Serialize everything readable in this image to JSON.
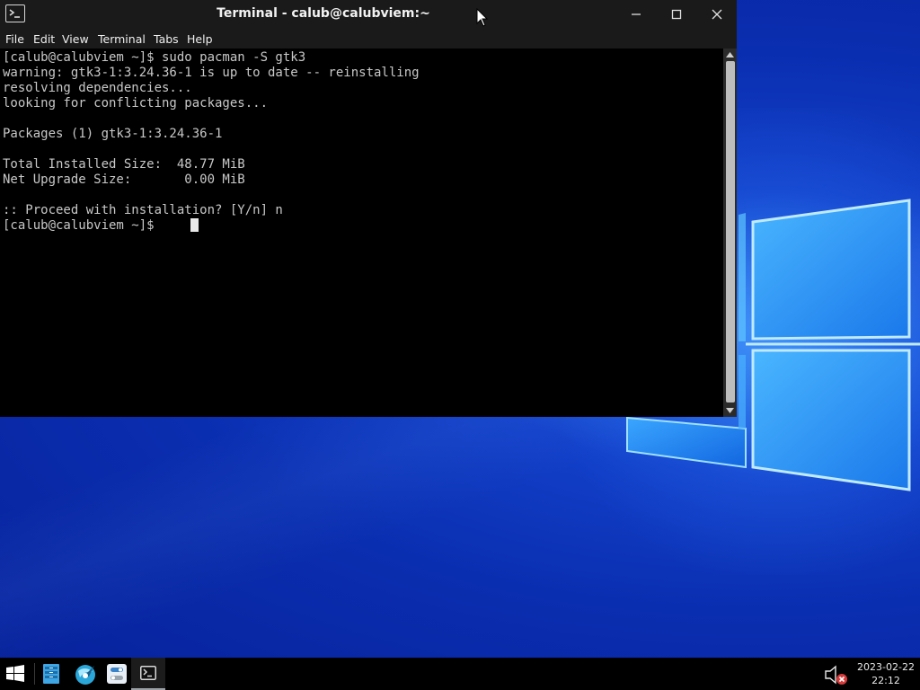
{
  "window": {
    "title": "Terminal - calub@calubviem:~",
    "controls": {
      "minimize_icon": "minimize-icon",
      "maximize_icon": "maximize-icon",
      "close_icon": "close-icon"
    }
  },
  "menu": {
    "items": [
      "File",
      "Edit",
      "View",
      "Terminal",
      "Tabs",
      "Help"
    ]
  },
  "terminal": {
    "lines": [
      "[calub@calubviem ~]$ sudo pacman -S gtk3",
      "warning: gtk3-1:3.24.36-1 is up to date -- reinstalling",
      "resolving dependencies...",
      "looking for conflicting packages...",
      "",
      "Packages (1) gtk3-1:3.24.36-1",
      "",
      "Total Installed Size:  48.77 MiB",
      "Net Upgrade Size:       0.00 MiB",
      "",
      ":: Proceed with installation? [Y/n] n",
      "[calub@calubviem ~]$ "
    ],
    "text_color": "#c8c8c8",
    "background": "#000000"
  },
  "taskbar": {
    "icons": [
      "windows-start-icon",
      "file-manager-icon",
      "browser-icon",
      "settings-icon",
      "terminal-icon"
    ],
    "tray": {
      "sound_icon": "speaker-muted-icon"
    },
    "clock": {
      "date": "2023-02-22",
      "time": "22:12"
    }
  },
  "colors": {
    "wallpaper": "#0a2eb0",
    "wallpaper_glow": "#2f7cf2",
    "titlebar": "#1a1a1a",
    "taskbar": "#000000"
  }
}
